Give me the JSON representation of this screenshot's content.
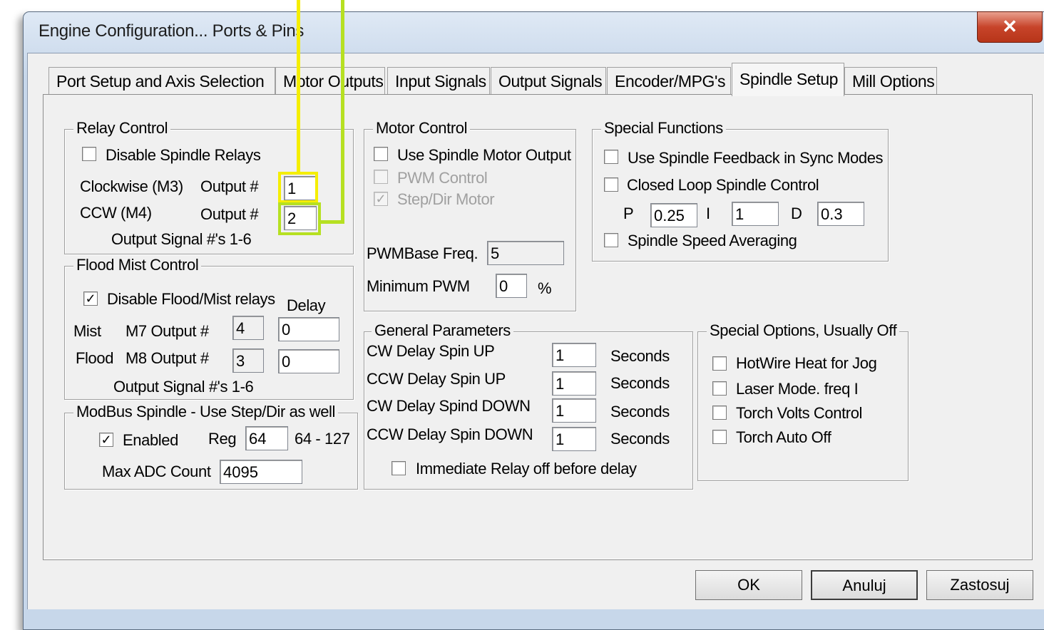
{
  "window": {
    "title": "Engine Configuration... Ports & Pins",
    "close_glyph": "✕"
  },
  "tabs": [
    {
      "label": "Port Setup and Axis Selection"
    },
    {
      "label": "Motor Outputs"
    },
    {
      "label": "Input Signals"
    },
    {
      "label": "Output Signals"
    },
    {
      "label": "Encoder/MPG's"
    },
    {
      "label": "Spindle Setup",
      "active": true
    },
    {
      "label": "Mill Options"
    }
  ],
  "relay_control": {
    "title": "Relay Control",
    "disable_label": "Disable Spindle Relays",
    "disable_checked": false,
    "cw_label": "Clockwise (M3)",
    "ccw_label": "CCW (M4)",
    "output_label": "Output #",
    "cw_output": "1",
    "ccw_output": "2",
    "note": "Output Signal #'s 1-6"
  },
  "flood_mist": {
    "title": "Flood Mist Control",
    "disable_label": "Disable Flood/Mist relays",
    "disable_checked": true,
    "delay_label": "Delay",
    "mist_label": "Mist",
    "m7_label": "M7 Output #",
    "m7_output": "4",
    "mist_delay": "0",
    "flood_label": "Flood",
    "m8_label": "M8 Output #",
    "m8_output": "3",
    "flood_delay": "0",
    "note": "Output Signal #'s 1-6"
  },
  "modbus": {
    "title": "ModBus Spindle - Use Step/Dir as well",
    "enabled_label": "Enabled",
    "enabled_checked": true,
    "reg_label": "Reg",
    "reg_value": "64",
    "reg_range": "64 - 127",
    "max_adc_label": "Max ADC Count",
    "max_adc_value": "4095"
  },
  "motor_control": {
    "title": "Motor Control",
    "use_spindle_label": "Use Spindle Motor Output",
    "pwm_control_label": "PWM Control",
    "stepdir_label": "Step/Dir Motor",
    "check": "✓",
    "pwm_base_label": "PWMBase Freq.",
    "pwm_base_value": "5",
    "min_pwm_label": "Minimum PWM",
    "min_pwm_value": "0",
    "percent": "%"
  },
  "special_functions": {
    "title": "Special Functions",
    "feedback_label": "Use Spindle Feedback in Sync Modes",
    "closed_loop_label": "Closed Loop Spindle Control",
    "p_label": "P",
    "p_value": "0.25",
    "i_label": "I",
    "i_value": "1",
    "d_label": "D",
    "d_value": "0.3",
    "averaging_label": "Spindle Speed Averaging"
  },
  "general_params": {
    "title": "General Parameters",
    "rows": [
      {
        "label": "CW Delay Spin UP",
        "value": "1",
        "unit": "Seconds"
      },
      {
        "label": "CCW Delay Spin UP",
        "value": "1",
        "unit": "Seconds"
      },
      {
        "label": "CW Delay Spind DOWN",
        "value": "1",
        "unit": "Seconds"
      },
      {
        "label": "CCW Delay Spin DOWN",
        "value": "1",
        "unit": "Seconds"
      }
    ],
    "immediate_label": "Immediate Relay off before delay"
  },
  "special_options": {
    "title": "Special Options, Usually Off",
    "items": [
      {
        "label": "HotWire Heat for Jog"
      },
      {
        "label": "Laser Mode. freq I"
      },
      {
        "label": "Torch Volts Control"
      },
      {
        "label": "Torch Auto Off"
      }
    ]
  },
  "buttons": {
    "ok": "OK",
    "cancel": "Anuluj",
    "apply": "Zastosuj"
  },
  "colors": {
    "highlight_yellow": "#f5ee00",
    "highlight_green": "#b6e022"
  }
}
